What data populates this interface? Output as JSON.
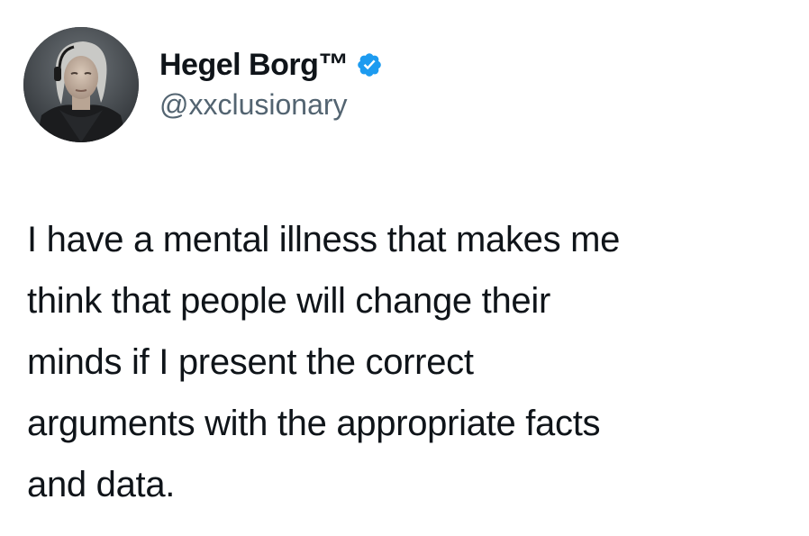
{
  "author": {
    "display_name": "Hegel Borg™",
    "handle": "@xxclusionary",
    "verified": true,
    "verified_badge_icon": "verified-badge-icon",
    "verified_color": "#1d9bf0"
  },
  "tweet": {
    "text_lines": [
      "I have a mental illness that makes me",
      "think that people will change their",
      "minds if I present the correct",
      "arguments with the appropriate facts",
      "and data."
    ]
  },
  "colors": {
    "text": "#0f1419",
    "secondary_text": "#536471",
    "background": "#ffffff"
  }
}
